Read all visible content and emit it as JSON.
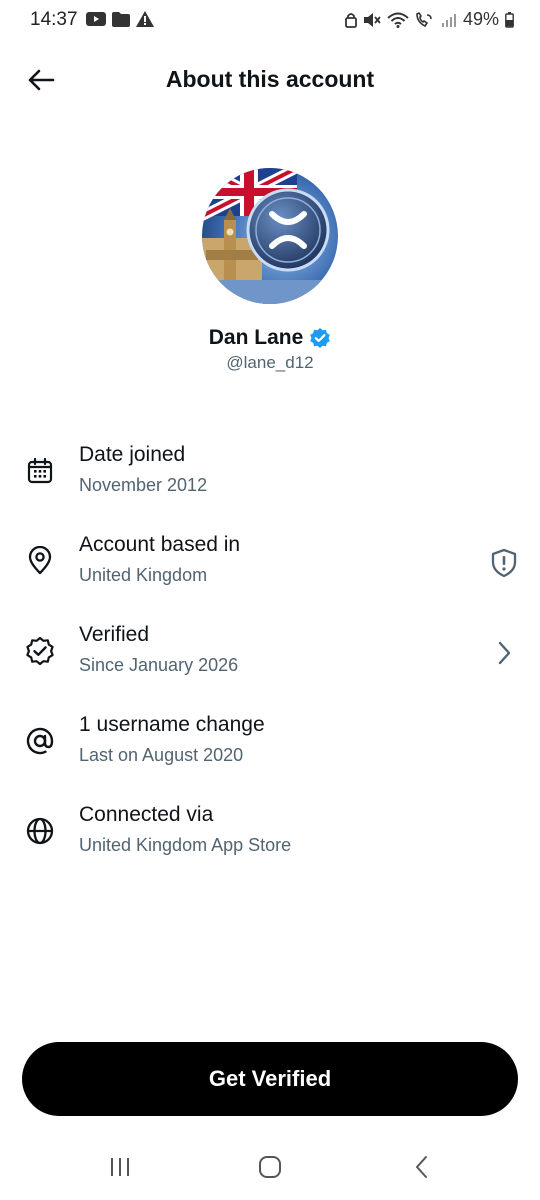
{
  "status_bar": {
    "time": "14:37",
    "battery": "49%",
    "left_icons": [
      "youtube-icon",
      "folder-icon",
      "warning-icon"
    ],
    "right_icons": [
      "lock-icon",
      "mute-icon",
      "wifi-icon",
      "wifi-calling-icon",
      "signal-icon",
      "battery-icon"
    ]
  },
  "header": {
    "title": "About this account",
    "back_icon": "arrow-left-icon"
  },
  "profile": {
    "name": "Dan Lane",
    "handle": "@lane_d12",
    "verified_badge_color": "#1d9bf0"
  },
  "details": [
    {
      "icon": "calendar-icon",
      "title": "Date joined",
      "subtitle": "November 2012"
    },
    {
      "icon": "location-pin-icon",
      "title": "Account based in",
      "subtitle": "United Kingdom",
      "action_icon": "shield-alert-icon"
    },
    {
      "icon": "verified-badge-icon",
      "title": "Verified",
      "subtitle": "Since January 2026",
      "action_icon": "chevron-right-icon"
    },
    {
      "icon": "at-sign-icon",
      "title": "1 username change",
      "subtitle": "Last on August 2020"
    },
    {
      "icon": "globe-icon",
      "title": "Connected via",
      "subtitle": "United Kingdom App Store"
    }
  ],
  "cta": {
    "label": "Get Verified"
  },
  "nav_bar": [
    "recent-apps-icon",
    "home-icon",
    "back-icon"
  ],
  "colors": {
    "text_primary": "#0f1419",
    "text_secondary": "#536471",
    "button_bg": "#000000",
    "accent": "#1d9bf0"
  }
}
